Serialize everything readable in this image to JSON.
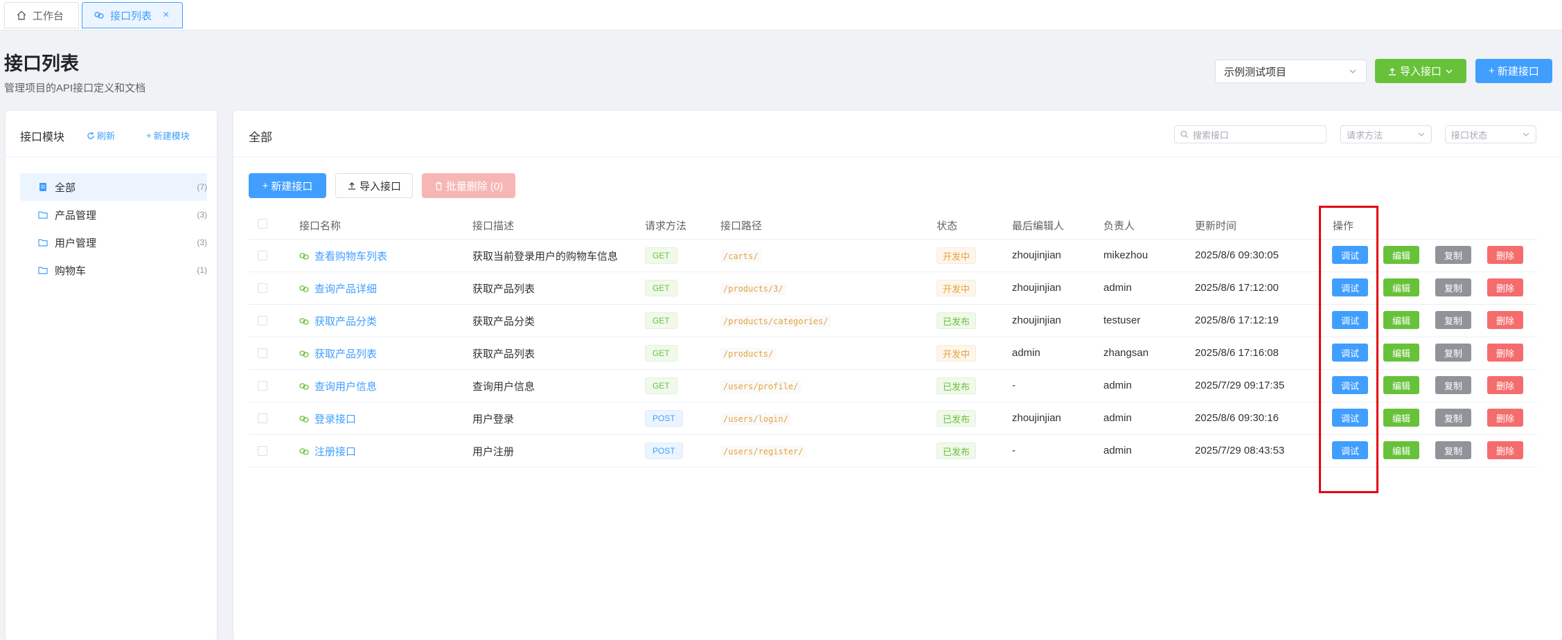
{
  "tabs": [
    {
      "label": "工作台",
      "icon": "home-icon"
    },
    {
      "label": "接口列表",
      "icon": "link-icon",
      "close": "×"
    }
  ],
  "header": {
    "title": "接口列表",
    "subtitle": "管理项目的API接口定义和文档",
    "project_select": "示例测试项目",
    "import_label": "导入接口",
    "new_label": "新建接口"
  },
  "sidebar": {
    "title": "接口模块",
    "refresh_label": "刷新",
    "new_module_label": "新建模块",
    "items": [
      {
        "label": "全部",
        "count": "(7)"
      },
      {
        "label": "产品管理",
        "count": "(3)"
      },
      {
        "label": "用户管理",
        "count": "(3)"
      },
      {
        "label": "购物车",
        "count": "(1)"
      }
    ]
  },
  "main": {
    "title": "全部",
    "search_placeholder": "搜索接口",
    "method_placeholder": "请求方法",
    "status_placeholder": "接口状态",
    "toolbar": {
      "new_label": "新建接口",
      "import_label": "导入接口",
      "batch_delete_label": "批量删除 (0)"
    },
    "columns": [
      "接口名称",
      "接口描述",
      "请求方法",
      "接口路径",
      "状态",
      "最后编辑人",
      "负责人",
      "更新时间",
      "操作"
    ],
    "rows": [
      {
        "name": "查看购物车列表",
        "desc": "获取当前登录用户的购物车信息",
        "method": "GET",
        "path": "/carts/",
        "status": "开发中",
        "editor": "zhoujinjian",
        "owner": "mikezhou",
        "updated": "2025/8/6 09:30:05"
      },
      {
        "name": "查询产品详细",
        "desc": "获取产品列表",
        "method": "GET",
        "path": "/products/3/",
        "status": "开发中",
        "editor": "zhoujinjian",
        "owner": "admin",
        "updated": "2025/8/6 17:12:00"
      },
      {
        "name": "获取产品分类",
        "desc": "获取产品分类",
        "method": "GET",
        "path": "/products/categories/",
        "status": "已发布",
        "editor": "zhoujinjian",
        "owner": "testuser",
        "updated": "2025/8/6 17:12:19"
      },
      {
        "name": "获取产品列表",
        "desc": "获取产品列表",
        "method": "GET",
        "path": "/products/",
        "status": "开发中",
        "editor": "admin",
        "owner": "zhangsan",
        "updated": "2025/8/6 17:16:08"
      },
      {
        "name": "查询用户信息",
        "desc": "查询用户信息",
        "method": "GET",
        "path": "/users/profile/",
        "status": "已发布",
        "editor": "-",
        "owner": "admin",
        "updated": "2025/7/29 09:17:35"
      },
      {
        "name": "登录接口",
        "desc": "用户登录",
        "method": "POST",
        "path": "/users/login/",
        "status": "已发布",
        "editor": "zhoujinjian",
        "owner": "admin",
        "updated": "2025/8/6 09:30:16"
      },
      {
        "name": "注册接口",
        "desc": "用户注册",
        "method": "POST",
        "path": "/users/register/",
        "status": "已发布",
        "editor": "-",
        "owner": "admin",
        "updated": "2025/7/29 08:43:53"
      }
    ],
    "actions": {
      "debug": "调试",
      "edit": "编辑",
      "copy": "复制",
      "delete": "删除"
    }
  },
  "colors": {
    "primary": "#409eff",
    "success": "#67c23a",
    "warning": "#e6a23c",
    "danger": "#f56c6c",
    "highlight": "#e60012"
  }
}
